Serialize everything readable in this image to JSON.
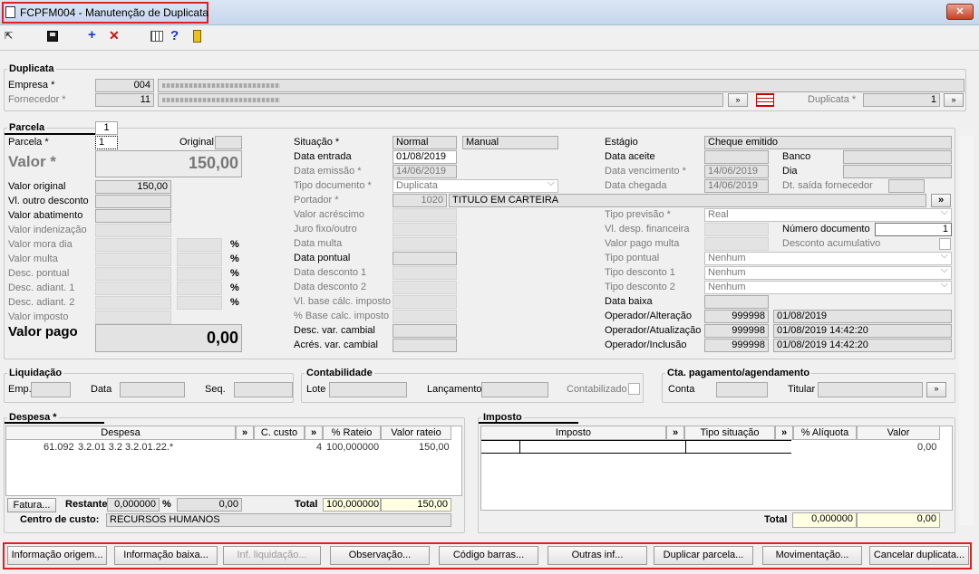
{
  "window": {
    "title": "FCPFM004 - Manutenção de Duplicata",
    "close": "✕"
  },
  "duplicata": {
    "group": "Duplicata",
    "empresa_label": "Empresa *",
    "empresa_code": "004",
    "fornecedor_label": "Fornecedor *",
    "fornecedor_code": "11",
    "duplicata_label": "Duplicata *",
    "duplicata_value": "1",
    "btn": "»"
  },
  "parcela": {
    "group": "Parcela",
    "num": "1",
    "parcela_label": "Parcela *",
    "parcela_value": "1",
    "original_label": "Original",
    "valor_label": "Valor *",
    "valor_value": "150,00",
    "valor_original_label": "Valor original",
    "valor_original": "150,00",
    "vl_outro_desconto": "Vl. outro desconto",
    "valor_abatimento": "Valor abatimento",
    "valor_indenizacao": "Valor indenização",
    "valor_mora_dia": "Valor mora dia",
    "valor_multa": "Valor multa",
    "desc_pontual": "Desc. pontual",
    "desc_adiant1": "Desc. adiant. 1",
    "desc_adiant2": "Desc. adiant. 2",
    "valor_imposto": "Valor imposto",
    "pct": "%",
    "valor_pago_label": "Valor pago",
    "valor_pago": "0,00"
  },
  "mid": {
    "situacao_label": "Situação *",
    "situacao1": "Normal",
    "situacao2": "Manual",
    "data_entrada_label": "Data entrada",
    "data_entrada": "01/08/2019",
    "data_emissao_label": "Data emissão *",
    "data_emissao": "14/06/2019",
    "tipo_doc_label": "Tipo documento *",
    "tipo_doc": "Duplicata",
    "portador_label": "Portador *",
    "portador_code": "1020",
    "portador_name": "TITULO EM CARTEIRA",
    "valor_acrescimo": "Valor acréscimo",
    "juro_fixo": "Juro fixo/outro",
    "data_multa": "Data multa",
    "data_pontual": "Data pontual",
    "data_desconto1": "Data desconto 1",
    "data_desconto2": "Data desconto 2",
    "vl_base": "Vl. base cálc. imposto",
    "pct_base": "% Base calc. imposto",
    "desc_var": "Desc. var. cambial",
    "acres_var": "Acrés. var. cambial"
  },
  "right": {
    "estagio_label": "Estágio",
    "estagio": "Cheque emitido",
    "data_aceite": "Data aceite",
    "banco": "Banco",
    "data_vencimento_label": "Data vencimento *",
    "data_vencimento": "14/06/2019",
    "dia": "Dia",
    "data_chegada_label": "Data chegada",
    "data_chegada": "14/06/2019",
    "dt_saida": "Dt. saída fornecedor",
    "tipo_previsao_label": "Tipo previsão *",
    "tipo_previsao": "Real",
    "vl_desp": "Vl. desp. financeira",
    "numero_doc_label": "Número documento",
    "numero_doc": "1",
    "valor_pago_multa": "Valor pago multa",
    "desconto_acum": "Desconto acumulativo",
    "tipo_pontual_label": "Tipo pontual",
    "tipo_desconto1_label": "Tipo desconto 1",
    "tipo_desconto2_label": "Tipo desconto 2",
    "nenhum": "Nenhum",
    "data_baixa": "Data baixa",
    "op_alt_label": "Operador/Alteração",
    "op_alt_code": "999998",
    "op_alt_date": "01/08/2019",
    "op_atu_label": "Operador/Atualização",
    "op_atu_code": "999998",
    "op_atu_date": "01/08/2019 14:42:20",
    "op_inc_label": "Operador/Inclusão",
    "op_inc_code": "999998",
    "op_inc_date": "01/08/2019 14:42:20"
  },
  "liquidacao": {
    "group": "Liquidação",
    "emp": "Emp.",
    "data": "Data",
    "seq": "Seq."
  },
  "contabilidade": {
    "group": "Contabilidade",
    "lote": "Lote",
    "lancamento": "Lançamento",
    "contabilizado": "Contabilizado"
  },
  "cta": {
    "group": "Cta. pagamento/agendamento",
    "conta": "Conta",
    "titular": "Titular"
  },
  "despesa": {
    "group": "Despesa *",
    "cols": [
      "Despesa",
      "»",
      "C. custo",
      "»",
      "% Rateio",
      "Valor rateio"
    ],
    "row": {
      "code": "61.092",
      "desc": "3.2.01 3.2 3.2.01.22.*",
      "ccusto": "4",
      "rateio": "100,000000",
      "valor": "150,00"
    },
    "fatura": "Fatura...",
    "restante_label": "Restante",
    "restante_pct": "0,000000",
    "pct": "%",
    "restante_val": "0,00",
    "total_label": "Total",
    "total_pct": "100,000000",
    "total_val": "150,00",
    "centro_label": "Centro de custo:",
    "centro": "RECURSOS HUMANOS"
  },
  "imposto": {
    "group": "Imposto",
    "cols": [
      "Imposto",
      "»",
      "Tipo situação",
      "»",
      "% Alíquota",
      "Valor"
    ],
    "row_valor": "0,00",
    "total_label": "Total",
    "total_pct": "0,000000",
    "total_val": "0,00"
  },
  "buttons": [
    "Informação origem...",
    "Informação baixa...",
    "Inf. liquidação...",
    "Observação...",
    "Código barras...",
    "Outras inf...",
    "Duplicar parcela...",
    "Movimentação...",
    "Cancelar duplicata..."
  ]
}
